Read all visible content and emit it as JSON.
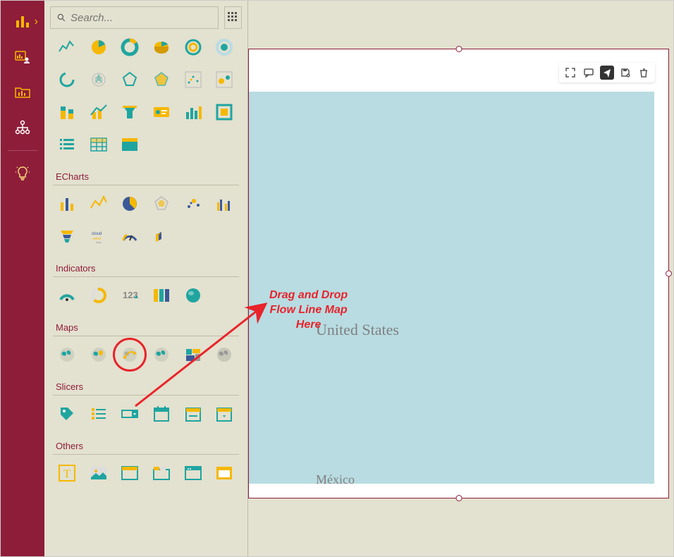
{
  "nav": {
    "items": [
      {
        "name": "charts",
        "active": true
      },
      {
        "name": "dashboard",
        "active": false
      },
      {
        "name": "folder",
        "active": false
      },
      {
        "name": "hierarchy",
        "active": false
      },
      {
        "name": "ideas",
        "active": false
      }
    ]
  },
  "search": {
    "placeholder": "Search..."
  },
  "sections": {
    "default": {
      "rows": 4
    },
    "echarts": {
      "title": "ECharts"
    },
    "indicators": {
      "title": "Indicators"
    },
    "maps": {
      "title": "Maps"
    },
    "slicers": {
      "title": "Slicers"
    },
    "others": {
      "title": "Others"
    }
  },
  "map": {
    "label_country": "United States",
    "label_south": "México"
  },
  "annotation": {
    "line1": "Drag and Drop",
    "line2": "Flow Line Map",
    "line3": "Here"
  },
  "colors": {
    "brand": "#8e1d3a",
    "accent_yellow": "#f5b800",
    "accent_teal": "#1fa5a0",
    "panel": "#e3e1cf",
    "water": "#b8dce2",
    "annotation": "#e8232a"
  },
  "toolbar": [
    "fullscreen",
    "comment",
    "share",
    "save",
    "delete"
  ]
}
